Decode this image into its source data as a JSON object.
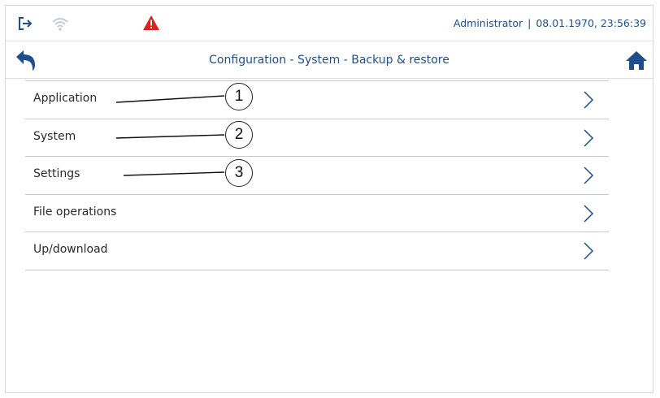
{
  "status_bar": {
    "user": "Administrator",
    "separator": "|",
    "datetime": "08.01.1970, 23:56:39",
    "icons": [
      "login-icon",
      "wifi-icon",
      "warning-icon"
    ],
    "warning_color": "#e0201b",
    "text_color": "#1f4e8c"
  },
  "title_bar": {
    "title": "Configuration - System - Backup & restore",
    "back_icon": "back-arrow-icon",
    "home_icon": "home-icon",
    "accent_color": "#1f4e8c"
  },
  "menu": {
    "items": [
      {
        "label": "Application"
      },
      {
        "label": "System"
      },
      {
        "label": "Settings"
      },
      {
        "label": "File operations"
      },
      {
        "label": "Up/download"
      }
    ]
  },
  "callouts": [
    "1",
    "2",
    "3"
  ]
}
